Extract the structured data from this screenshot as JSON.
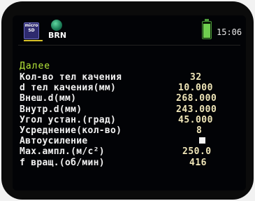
{
  "status": {
    "sd_icon_text": [
      "micro",
      "SD"
    ],
    "brn_label": "BRN",
    "time": "15:06"
  },
  "menu": {
    "header": "Далее",
    "items": [
      {
        "label": "Кол-во тел качения",
        "value": "32"
      },
      {
        "label": "d тел качения(мм)",
        "value": "10.000"
      },
      {
        "label": "Внеш.d(мм)",
        "value": "268.000"
      },
      {
        "label": "Внутр.d(мм)",
        "value": "243.000"
      },
      {
        "label": "Угол устан.(град)",
        "value": "45.000"
      },
      {
        "label": "Усреднение(кол-во)",
        "value": "8"
      },
      {
        "label": "Автоусиление",
        "value_checked": true
      },
      {
        "label": "Max.ампл.(м/с²)",
        "value": "250.0"
      },
      {
        "label": "f вращ.(об/мин)",
        "value": "416"
      }
    ]
  },
  "colors": {
    "header": "#b8ea3a",
    "label": "#f2f2f2",
    "value": "#f0e6b8",
    "battery": "#6fcf4f"
  }
}
